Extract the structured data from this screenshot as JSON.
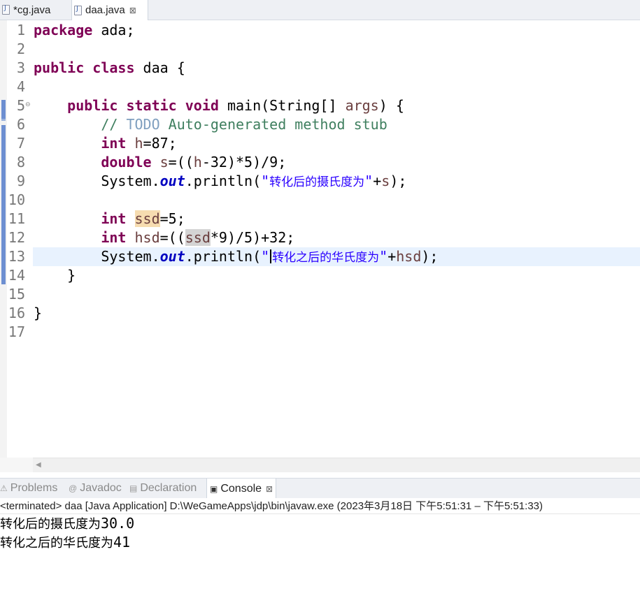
{
  "editor_tabs": [
    {
      "label": "*cg.java",
      "active": false
    },
    {
      "label": "daa.java",
      "active": true,
      "close": "⊠"
    }
  ],
  "code": {
    "line_numbers": [
      "1",
      "2",
      "3",
      "4",
      "5",
      "6",
      "7",
      "8",
      "9",
      "10",
      "11",
      "12",
      "13",
      "14",
      "15",
      "16",
      "17"
    ],
    "l1": {
      "kw": "package",
      "rest": " ada;"
    },
    "l3": {
      "kw1": "public",
      "kw2": "class",
      "rest": " daa {"
    },
    "l5": {
      "kw1": "public",
      "kw2": "static",
      "kw3": "void",
      "a": " main(String[] ",
      "args": "args",
      "b": ") {"
    },
    "l6": {
      "a": "// ",
      "todo": "TODO",
      "b": " Auto-generated method stub"
    },
    "l7": {
      "kw": "int",
      "h": "h",
      "rest": "=87;"
    },
    "l8": {
      "kw": "double",
      "s": "s",
      "a": "=((",
      "h": "h",
      "b": "-32)*5)/9;"
    },
    "l9": {
      "a": "System.",
      "out": "out",
      "b": ".println(",
      "q": "\"",
      "str": "转化后的摄氏度为",
      "q2": "\"",
      "c": "+",
      "s": "s",
      "d": ");"
    },
    "l11": {
      "kw": "int",
      "ssd": "ssd",
      "rest": "=5;"
    },
    "l12": {
      "kw": "int",
      "hsd": "hsd",
      "a": "=((",
      "ssd": "ssd",
      "b": "*9)/5)+32;"
    },
    "l13": {
      "a": "System.",
      "out": "out",
      "b": ".println(",
      "q": "\"",
      "str": "转化之后的华氏度为",
      "q2": "\"",
      "c": "+",
      "hsd": "hsd",
      "d": ");"
    },
    "l14": "}",
    "l16": "}"
  },
  "views_tabs": [
    {
      "label": "Problems",
      "icon": "problems-icon"
    },
    {
      "label": "Javadoc",
      "icon": "at-icon"
    },
    {
      "label": "Declaration",
      "icon": "declaration-icon"
    },
    {
      "label": "Console",
      "icon": "console-icon",
      "active": true,
      "close": "⊠"
    }
  ],
  "console": {
    "description": "<terminated> daa [Java Application] D:\\WeGameApps\\jdp\\bin\\javaw.exe  (2023年3月18日 下午5:51:31 – 下午5:51:33)",
    "lines": [
      {
        "text": "转化后的摄氏度为",
        "value": "30.0"
      },
      {
        "text": "转化之后的华氏度为",
        "value": "41"
      }
    ]
  },
  "colors": {
    "keyword": "#7f0055",
    "comment": "#3f7f5f",
    "string": "#2a00ff",
    "field": "#0000c0",
    "current_line": "#e8f2fe",
    "write_occurrence": "#f6dcb0",
    "read_occurrence": "#d4d4d4"
  }
}
